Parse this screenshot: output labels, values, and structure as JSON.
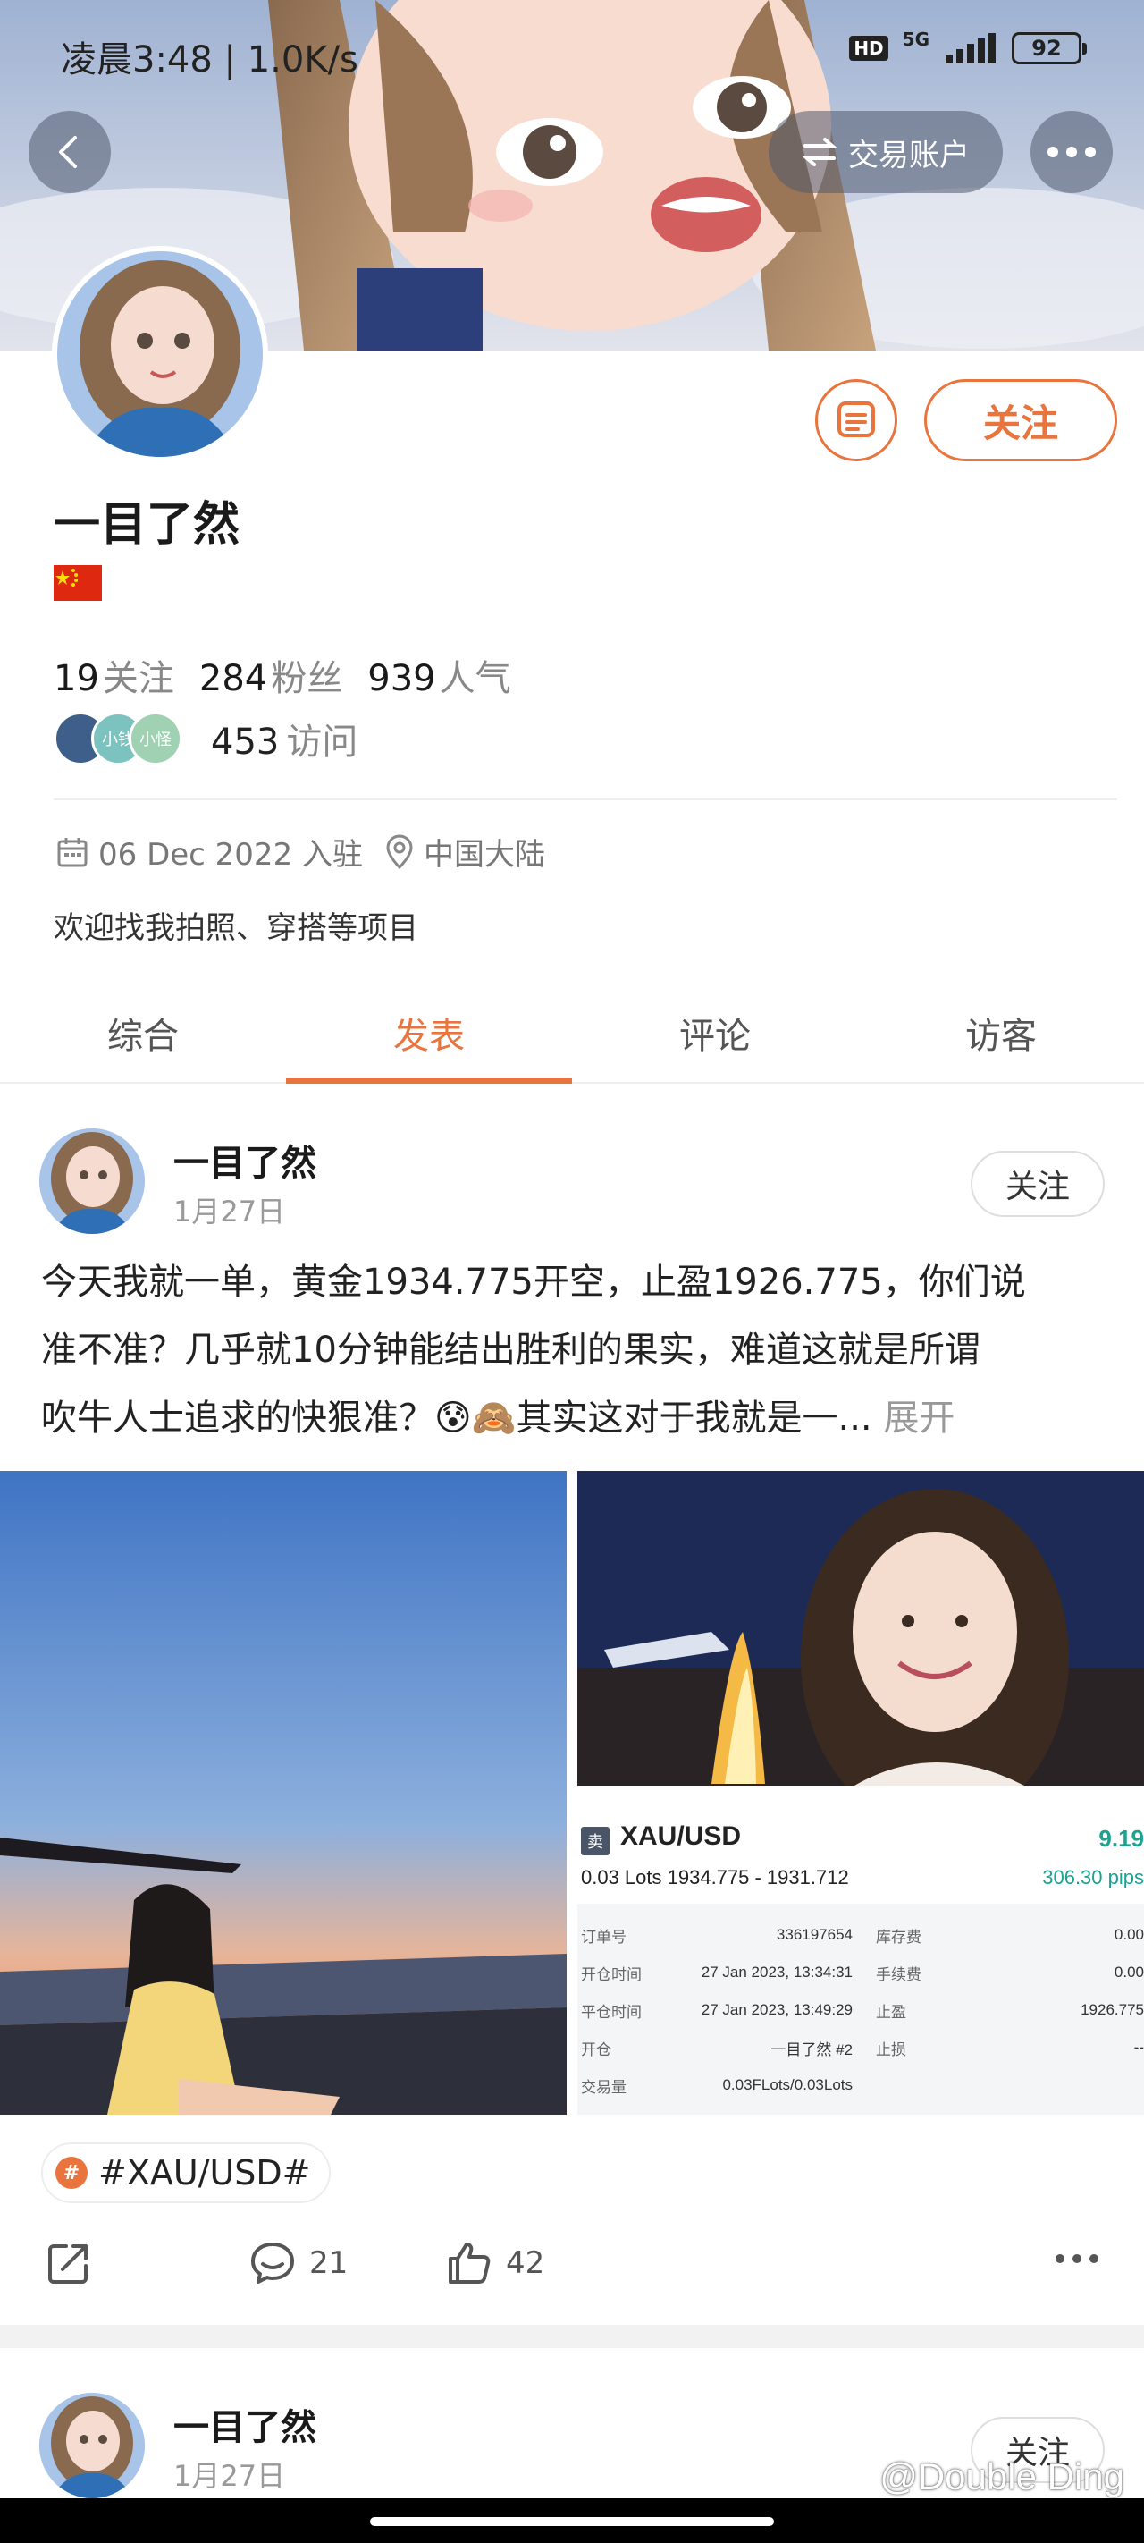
{
  "status_bar": {
    "time": "凌晨3:48 | 1.0K/s",
    "hd": "HD",
    "network": "5G",
    "battery": "92"
  },
  "header": {
    "back_icon": "chevron-left-icon",
    "trade_account_label": "交易账户",
    "more_icon": "more-horizontal-icon"
  },
  "profile": {
    "name": "一目了然",
    "follow_label": "关注",
    "stats": {
      "following_count": "19",
      "following_label": "关注",
      "fans_count": "284",
      "fans_label": "粉丝",
      "popularity_count": "939",
      "popularity_label": "人气"
    },
    "visitor_avatars": [
      "",
      "小钱",
      "小怪"
    ],
    "visits_count": "453",
    "visits_label": "访问",
    "joined": "06 Dec 2022 入驻",
    "location": "中国大陆",
    "bio": "欢迎找我拍照、穿搭等项目"
  },
  "tabs": [
    {
      "label": "综合",
      "active": false
    },
    {
      "label": "发表",
      "active": true
    },
    {
      "label": "评论",
      "active": false
    },
    {
      "label": "访客",
      "active": false
    }
  ],
  "post": {
    "author": "一目了然",
    "date": "1月27日",
    "follow_label": "关注",
    "text_line1": "今天我就一单，黄金1934.775开空，止盈1926.775，你们说",
    "text_line2": "准不准？几乎就10分钟能结出胜利的果实，难道这就是所谓",
    "text_line3": "吹牛人士追求的快狠准？😰🙈其实这对于我就是一...",
    "expand_label": "展开",
    "trade_card": {
      "side": "卖",
      "symbol": "XAU/USD",
      "profit": "9.19",
      "lots": "0.03 Lots  1934.775 - 1931.712",
      "pips": "306.30 pips",
      "rows": [
        {
          "k1": "订单号",
          "v1": "336197654",
          "k2": "库存费",
          "v2": "0.00"
        },
        {
          "k1": "开仓时间",
          "v1": "27 Jan 2023, 13:34:31",
          "k2": "手续费",
          "v2": "0.00"
        },
        {
          "k1": "平仓时间",
          "v1": "27 Jan 2023, 13:49:29",
          "k2": "止盈",
          "v2": "1926.775"
        },
        {
          "k1": "开仓",
          "v1": "一目了然 #2",
          "k2": "止损",
          "v2": "--"
        },
        {
          "k1": "交易量",
          "v1": "0.03FLots/0.03Lots",
          "k2": "",
          "v2": ""
        }
      ]
    },
    "tag": "#XAU/USD#",
    "comments": "21",
    "likes": "42"
  },
  "next_post": {
    "author": "一目了然",
    "date": "1月27日",
    "follow_label": "关注"
  },
  "watermark": "@Double Ding",
  "colors": {
    "accent": "#e9743d",
    "profit_green": "#1aa390"
  }
}
